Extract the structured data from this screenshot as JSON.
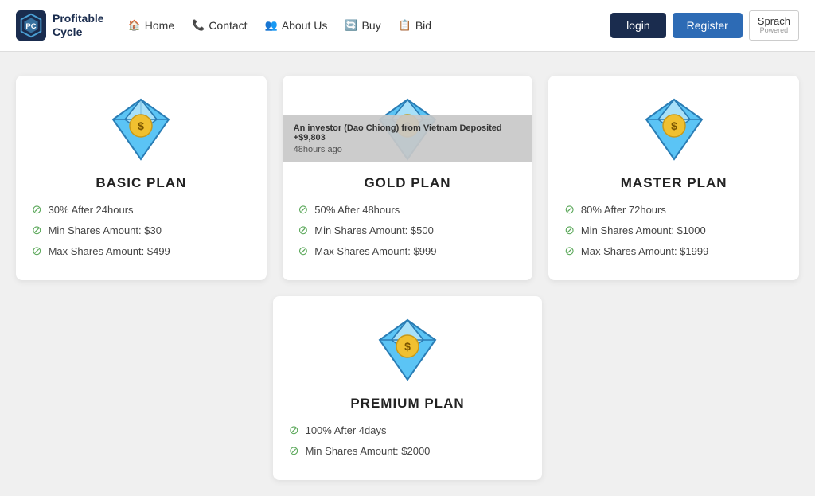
{
  "site": {
    "name_line1": "Profitable",
    "name_line2": "Cycle"
  },
  "navbar": {
    "home_label": "Home",
    "contact_label": "Contact",
    "about_label": "About Us",
    "buy_label": "Buy",
    "bid_label": "Bid",
    "login_label": "login",
    "register_label": "Register",
    "sprach_label": "Sprach",
    "powered_label": "Powered"
  },
  "toast": {
    "message": "An investor (Dao Chiong) from Vietnam Deposited +$9,803",
    "time": "48hours ago"
  },
  "plans": [
    {
      "id": "basic",
      "name": "BASIC PLAN",
      "features": [
        "30% After 24hours",
        "Min Shares Amount: $30",
        "Max Shares Amount: $499"
      ]
    },
    {
      "id": "gold",
      "name": "GOLD PLAN",
      "features": [
        "50% After 48hours",
        "Min Shares Amount: $500",
        "Max Shares Amount: $999"
      ]
    },
    {
      "id": "master",
      "name": "MASTER PLAN",
      "features": [
        "80% After 72hours",
        "Min Shares Amount: $1000",
        "Max Shares Amount: $1999"
      ]
    }
  ],
  "bottom_plan": {
    "id": "premium",
    "name": "PREMIUM PLAN",
    "features": [
      "100% After 4days",
      "Min Shares Amount: $2000"
    ]
  },
  "diamond_colors": {
    "basic": {
      "body": "#5bc4f5",
      "outline": "#2a7db5",
      "coin": "#f0c030"
    },
    "gold": {
      "body": "#5bc4f5",
      "outline": "#2a7db5",
      "coin": "#f0c030"
    },
    "master": {
      "body": "#5bc4f5",
      "outline": "#2a7db5",
      "coin": "#f0c030"
    },
    "premium": {
      "body": "#5bc4f5",
      "outline": "#2a7db5",
      "coin": "#f0c030"
    }
  }
}
